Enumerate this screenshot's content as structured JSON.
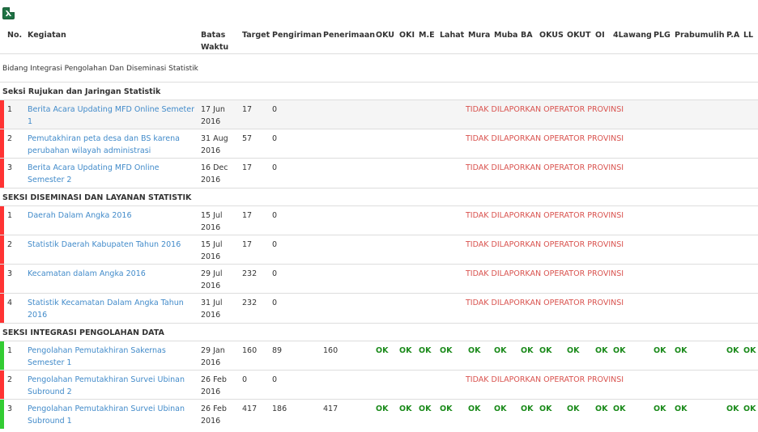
{
  "export": {
    "icon": "excel-export-icon",
    "glyph": "X"
  },
  "headers": {
    "no": "No.",
    "kegiatan": "Kegiatan",
    "batas1": "Batas",
    "batas2": "Waktu",
    "target": "Target",
    "pengiriman": "Pengiriman",
    "penerimaan": "Penerimaan",
    "oku": "OKU",
    "oki": "OKI",
    "me": "M.E",
    "lahat": "Lahat",
    "mura": "Mura",
    "muba": "Muba",
    "ba": "BA",
    "okus": "OKUS",
    "okut": "OKUT",
    "oi": "OI",
    "empatlawang": "4Lawang",
    "plg": "PLG",
    "prabumulih": "Prabumulih",
    "pa": "P.A",
    "ll": "LL"
  },
  "bidang": "Bidang Integrasi Pengolahan Dan Diseminasi Statistik",
  "colors": {
    "red": "#ff3333",
    "green": "#33cc33",
    "link": "#428bca",
    "status": "#d9534f",
    "ok": "#1a8a1a"
  },
  "sections": [
    {
      "title": "Seksi Rujukan dan Jaringan Statistik",
      "rows": [
        {
          "no": "1",
          "kegiatan": "Berita Acara Updating MFD Online Semeter 1",
          "batas1": "17 Jun",
          "batas2": "2016",
          "target": "17",
          "pengiriman": "0",
          "penerimaan": "",
          "status": "TIDAK DILAPORKAN OPERATOR PROVINSI",
          "bar": "red"
        },
        {
          "no": "2",
          "kegiatan": "Pemutakhiran peta desa dan BS karena perubahan wilayah administrasi",
          "batas1": "31 Aug",
          "batas2": "2016",
          "target": "57",
          "pengiriman": "0",
          "penerimaan": "",
          "status": "TIDAK DILAPORKAN OPERATOR PROVINSI",
          "bar": "red"
        },
        {
          "no": "3",
          "kegiatan": "Berita Acara Updating MFD Online Semester 2",
          "batas1": "16 Dec",
          "batas2": "2016",
          "target": "17",
          "pengiriman": "0",
          "penerimaan": "",
          "status": "TIDAK DILAPORKAN OPERATOR PROVINSI",
          "bar": "red"
        }
      ]
    },
    {
      "title": "SEKSI DISEMINASI DAN LAYANAN STATISTIK",
      "rows": [
        {
          "no": "1",
          "kegiatan": "Daerah Dalam Angka 2016",
          "batas1": "15 Jul",
          "batas2": "2016",
          "target": "17",
          "pengiriman": "0",
          "penerimaan": "",
          "status": "TIDAK DILAPORKAN OPERATOR PROVINSI",
          "bar": "red"
        },
        {
          "no": "2",
          "kegiatan": "Statistik Daerah Kabupaten Tahun 2016",
          "batas1": "15 Jul",
          "batas2": "2016",
          "target": "17",
          "pengiriman": "0",
          "penerimaan": "",
          "status": "TIDAK DILAPORKAN OPERATOR PROVINSI",
          "bar": "red"
        },
        {
          "no": "3",
          "kegiatan": "Kecamatan dalam Angka 2016",
          "batas1": "29 Jul",
          "batas2": "2016",
          "target": "232",
          "pengiriman": "0",
          "penerimaan": "",
          "status": "TIDAK DILAPORKAN OPERATOR PROVINSI",
          "bar": "red"
        },
        {
          "no": "4",
          "kegiatan": "Statistik Kecamatan Dalam Angka Tahun 2016",
          "batas1": "31 Jul",
          "batas2": "2016",
          "target": "232",
          "pengiriman": "0",
          "penerimaan": "",
          "status": "TIDAK DILAPORKAN OPERATOR PROVINSI",
          "bar": "red"
        }
      ]
    },
    {
      "title": "SEKSI INTEGRASI PENGOLAHAN DATA",
      "rows": [
        {
          "no": "1",
          "kegiatan": "Pengolahan Pemutakhiran Sakernas Semester 1",
          "batas1": "29 Jan",
          "batas2": "2016",
          "target": "160",
          "pengiriman": "89",
          "penerimaan": "160",
          "status": "",
          "bar": "green",
          "ok": {
            "oku": "OK",
            "oki": "OK",
            "me": "OK",
            "lahat": "OK",
            "mura": "OK",
            "muba": "OK",
            "ba": "OK",
            "okus": "OK",
            "okut": "OK",
            "oi": "OK",
            "empatlawang": "OK",
            "plg": "OK",
            "prabumulih": "OK",
            "pa": "OK",
            "ll": "OK"
          }
        },
        {
          "no": "2",
          "kegiatan": "Pengolahan Pemutakhiran Survei Ubinan Subround 2",
          "batas1": "26 Feb",
          "batas2": "2016",
          "target": "0",
          "pengiriman": "0",
          "penerimaan": "",
          "status": "TIDAK DILAPORKAN OPERATOR PROVINSI",
          "bar": "red"
        },
        {
          "no": "3",
          "kegiatan": "Pengolahan Pemutakhiran Survei Ubinan Subround 1",
          "batas1": "26 Feb",
          "batas2": "2016",
          "target": "417",
          "pengiriman": "186",
          "penerimaan": "417",
          "status": "",
          "bar": "green",
          "ok": {
            "oku": "OK",
            "oki": "OK",
            "me": "OK",
            "lahat": "OK",
            "mura": "OK",
            "muba": "OK",
            "ba": "OK",
            "okus": "OK",
            "okut": "OK",
            "oi": "OK",
            "empatlawang": "OK",
            "plg": "OK",
            "prabumulih": "OK",
            "pa": "OK",
            "ll": "OK"
          }
        }
      ]
    }
  ]
}
